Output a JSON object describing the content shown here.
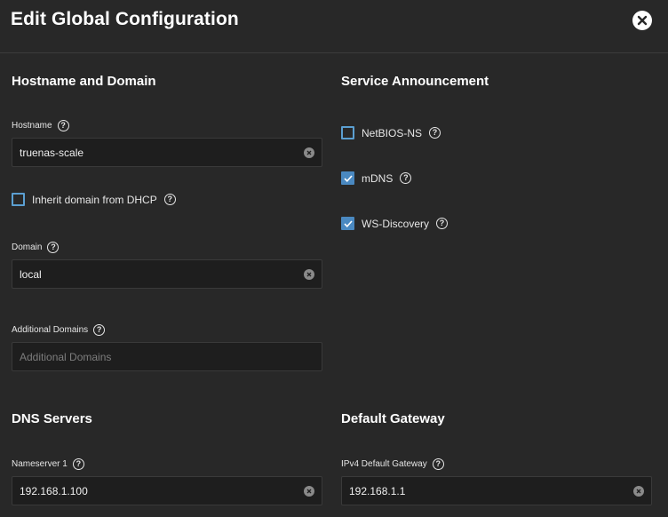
{
  "header": {
    "title": "Edit Global Configuration"
  },
  "sections": {
    "hostname_domain": "Hostname and Domain",
    "service_announcement": "Service Announcement",
    "dns_servers": "DNS Servers",
    "default_gateway": "Default Gateway"
  },
  "fields": {
    "hostname": {
      "label": "Hostname",
      "value": "truenas-scale"
    },
    "inherit_domain": {
      "label": "Inherit domain from DHCP",
      "checked": false
    },
    "domain": {
      "label": "Domain",
      "value": "local"
    },
    "additional_domains": {
      "label": "Additional Domains",
      "placeholder": "Additional Domains"
    },
    "nameserver1": {
      "label": "Nameserver 1",
      "value": "192.168.1.100"
    },
    "ipv4_gateway": {
      "label": "IPv4 Default Gateway",
      "value": "192.168.1.1"
    }
  },
  "service_announcement": {
    "netbios": {
      "label": "NetBIOS-NS",
      "checked": false
    },
    "mdns": {
      "label": "mDNS",
      "checked": true
    },
    "ws_discovery": {
      "label": "WS-Discovery",
      "checked": true
    }
  },
  "icons": {
    "help": "?",
    "close": "close-icon",
    "clear": "clear-icon",
    "check": "check-icon"
  },
  "colors": {
    "background": "#282828",
    "input_bg": "#1e1e1e",
    "accent": "#4a89c1"
  }
}
